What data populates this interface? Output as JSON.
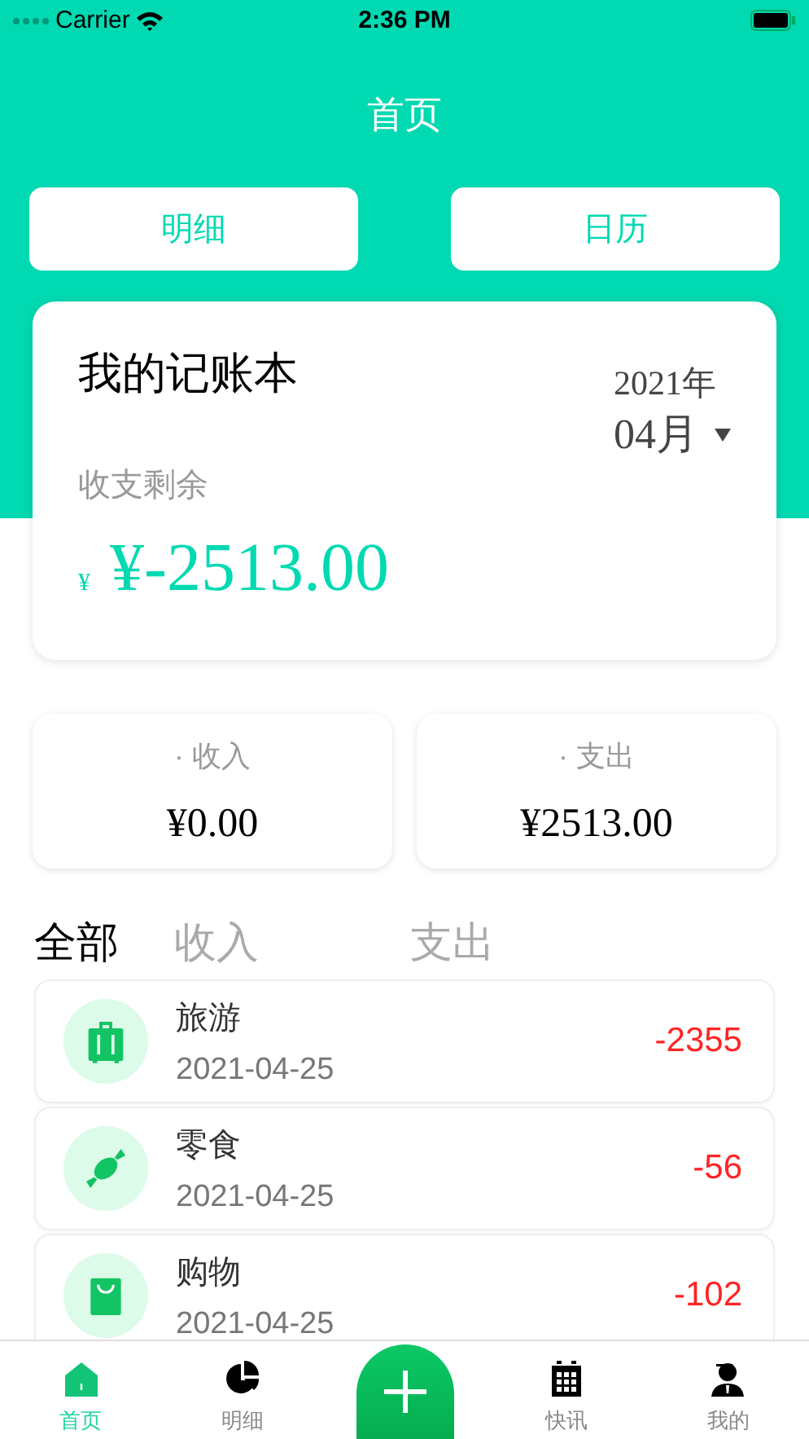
{
  "status_bar": {
    "carrier": "Carrier",
    "time": "2:36 PM"
  },
  "header": {
    "title": "首页",
    "buttons": [
      "明细",
      "日历"
    ]
  },
  "ledger": {
    "title": "我的记账本",
    "year": "2021年",
    "month": "04月",
    "balance_label": "收支剩余",
    "currency": "¥",
    "balance": "¥-2513.00"
  },
  "totals": [
    {
      "label": "· 收入",
      "value": "¥0.00"
    },
    {
      "label": "· 支出",
      "value": "¥2513.00"
    }
  ],
  "filters": [
    {
      "label": "全部",
      "selected": true
    },
    {
      "label": "收入",
      "selected": false
    },
    {
      "label": "支出",
      "selected": false
    }
  ],
  "records": [
    {
      "kind": "suitcase",
      "name": "旅游",
      "date": "2021-04-25",
      "amount": "-2355"
    },
    {
      "kind": "candy",
      "name": "零食",
      "date": "2021-04-25",
      "amount": "-56"
    },
    {
      "kind": "bag",
      "name": "购物",
      "date": "2021-04-25",
      "amount": "-102"
    }
  ],
  "tab_bar": [
    {
      "kind": "home",
      "label": "首页",
      "selected": true
    },
    {
      "kind": "chart",
      "label": "明细",
      "selected": false
    },
    {
      "kind": "add"
    },
    {
      "kind": "calendar",
      "label": "快讯",
      "selected": false
    },
    {
      "kind": "person",
      "label": "我的",
      "selected": false
    }
  ]
}
